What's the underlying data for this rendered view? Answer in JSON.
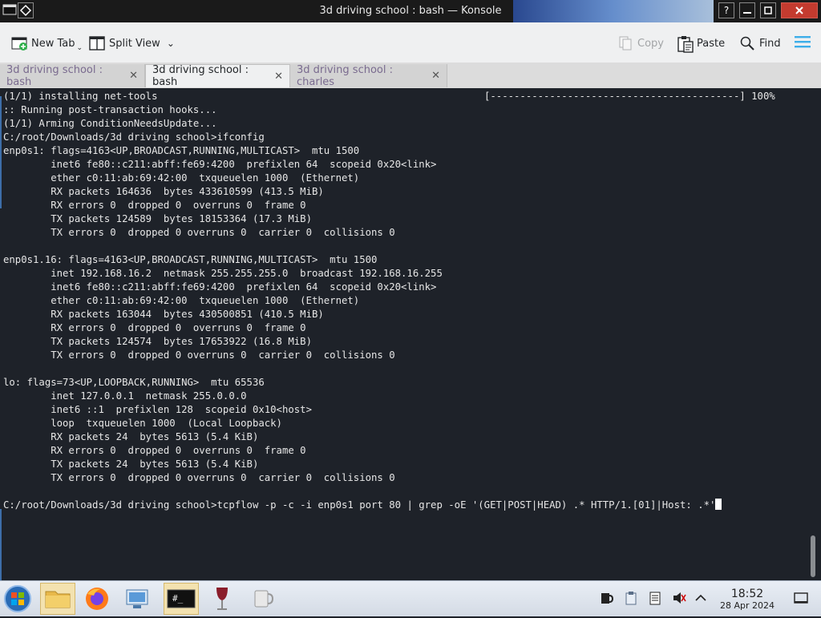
{
  "window": {
    "title": "3d driving school : bash — Konsole"
  },
  "toolbar": {
    "new_tab": "New Tab",
    "split_view": "Split View",
    "copy": "Copy",
    "paste": "Paste",
    "find": "Find"
  },
  "tabs": [
    {
      "label": "3d driving school : bash",
      "active": false
    },
    {
      "label": "3d driving school : bash",
      "active": true
    },
    {
      "label": "3d driving school : charles",
      "active": false
    }
  ],
  "terminal": {
    "progress": "[------------------------------------------] 100%",
    "prompt": "C:/root/Downloads/3d driving school>",
    "command": "tcpflow -p -c -i enp0s1 port 80 | grep -oE '(GET|POST|HEAD) .* HTTP/1.[01]|Host: .*'",
    "lines": [
      "(1/1) installing net-tools",
      ":: Running post-transaction hooks...",
      "(1/1) Arming ConditionNeedsUpdate...",
      "C:/root/Downloads/3d driving school>ifconfig",
      "enp0s1: flags=4163<UP,BROADCAST,RUNNING,MULTICAST>  mtu 1500",
      "        inet6 fe80::c211:abff:fe69:4200  prefixlen 64  scopeid 0x20<link>",
      "        ether c0:11:ab:69:42:00  txqueuelen 1000  (Ethernet)",
      "        RX packets 164636  bytes 433610599 (413.5 MiB)",
      "        RX errors 0  dropped 0  overruns 0  frame 0",
      "        TX packets 124589  bytes 18153364 (17.3 MiB)",
      "        TX errors 0  dropped 0 overruns 0  carrier 0  collisions 0",
      "",
      "enp0s1.16: flags=4163<UP,BROADCAST,RUNNING,MULTICAST>  mtu 1500",
      "        inet 192.168.16.2  netmask 255.255.255.0  broadcast 192.168.16.255",
      "        inet6 fe80::c211:abff:fe69:4200  prefixlen 64  scopeid 0x20<link>",
      "        ether c0:11:ab:69:42:00  txqueuelen 1000  (Ethernet)",
      "        RX packets 163044  bytes 430500851 (410.5 MiB)",
      "        RX errors 0  dropped 0  overruns 0  frame 0",
      "        TX packets 124574  bytes 17653922 (16.8 MiB)",
      "        TX errors 0  dropped 0 overruns 0  carrier 0  collisions 0",
      "",
      "lo: flags=73<UP,LOOPBACK,RUNNING>  mtu 65536",
      "        inet 127.0.0.1  netmask 255.0.0.0",
      "        inet6 ::1  prefixlen 128  scopeid 0x10<host>",
      "        loop  txqueuelen 1000  (Local Loopback)",
      "        RX packets 24  bytes 5613 (5.4 KiB)",
      "        RX errors 0  dropped 0  overruns 0  frame 0",
      "        TX packets 24  bytes 5613 (5.4 KiB)",
      "        TX errors 0  dropped 0 overruns 0  carrier 0  collisions 0",
      ""
    ]
  },
  "taskbar": {
    "apps": [
      "start-orb-icon",
      "file-manager-icon",
      "firefox-icon",
      "control-panel-icon",
      "terminal-icon",
      "wine-icon",
      "mug-icon"
    ],
    "terminal_glyph": "#_",
    "clock_time": "18:52",
    "clock_date": "28 Apr 2024"
  },
  "colors": {
    "terminal_bg": "#1e2229",
    "terminal_fg": "#e6e6e6",
    "accent": "#3daee9",
    "inactive_tab_text": "#7a6b8f"
  }
}
